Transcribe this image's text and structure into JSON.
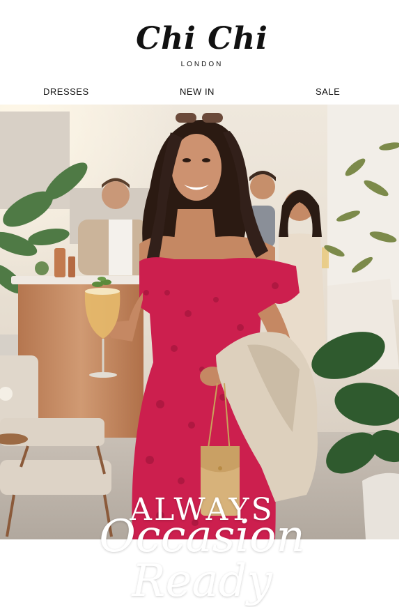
{
  "brand": {
    "name": "Chi Chi",
    "sub": "LONDON"
  },
  "nav": [
    {
      "label": "DRESSES"
    },
    {
      "label": "NEW IN"
    },
    {
      "label": "SALE"
    }
  ],
  "hero": {
    "headline_line1": "ALWAYS",
    "headline_line2": "Occasion Ready"
  },
  "colors": {
    "dress": "#cc1f4e",
    "jacket": "#ddd0bd",
    "sky": "#ece7df",
    "bar": "#c38760"
  }
}
